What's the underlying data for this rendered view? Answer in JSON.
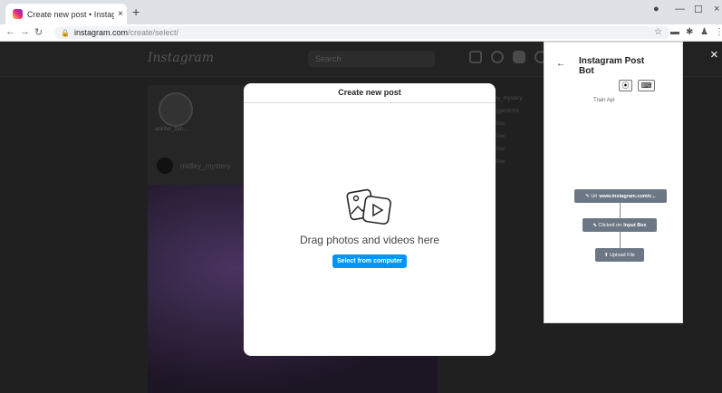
{
  "browser": {
    "tab_title": "Create new post • Instagram",
    "tab_close": "×",
    "new_tab": "+",
    "url_domain": "instagram.com",
    "url_path": "/create/select/",
    "window_controls": [
      "—",
      "☐",
      "×"
    ]
  },
  "instagram": {
    "logo": "Instagram",
    "search_placeholder": "Search",
    "story_name": "ankiter_zan...",
    "post_username": "midley_mystery",
    "sidebar": [
      "niley_mystery",
      "Suggestions",
      "Follow",
      "Follow",
      "Follow",
      "Follow"
    ]
  },
  "modal": {
    "title": "Create new post",
    "drag_text": "Drag photos and videos here",
    "select_button": "Select from computer",
    "close": "×"
  },
  "bot": {
    "back": "←",
    "title": "Instagram Post Bot",
    "train_label": "Train Api",
    "steps": [
      {
        "prefix": "✎ Url",
        "bold": "www.instagram.com/c..."
      },
      {
        "prefix": "⬉ Clicked on",
        "bold": "Input Box"
      },
      {
        "prefix": "⬆ Upload File",
        "bold": ""
      }
    ]
  },
  "colors": {
    "primary_button": "#0095f6",
    "step_bg": "#6b7785"
  }
}
